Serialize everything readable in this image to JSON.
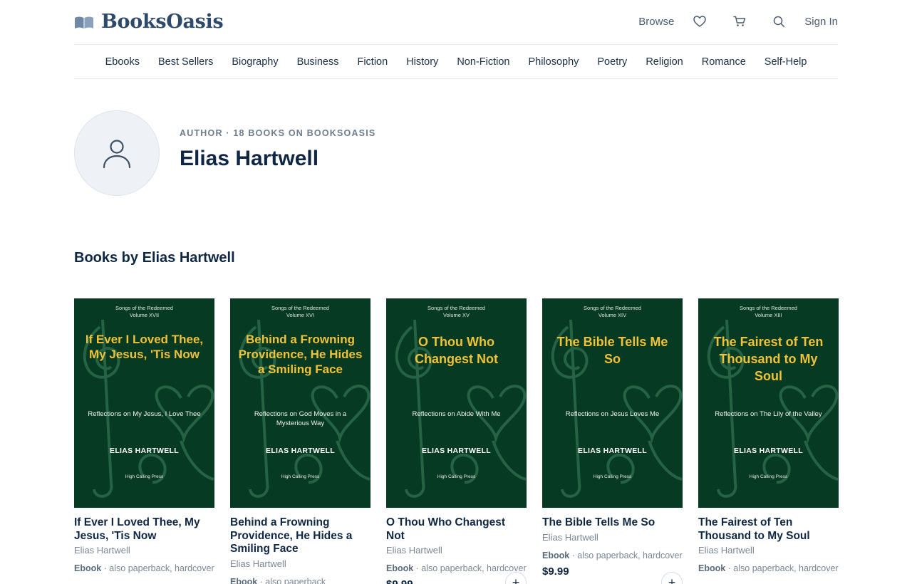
{
  "header": {
    "brand": "BooksOasis",
    "browse_label": "Browse",
    "signin_label": "Sign In",
    "icons": [
      "book-logo-icon",
      "heart-icon",
      "cart-icon",
      "search-icon"
    ]
  },
  "categories": [
    "Ebooks",
    "Best Sellers",
    "Biography",
    "Business",
    "Fiction",
    "History",
    "Non-Fiction",
    "Philosophy",
    "Poetry",
    "Religion",
    "Romance",
    "Self-Help"
  ],
  "author": {
    "meta": "AUTHOR · 18 BOOKS ON BOOKSOASIS",
    "name": "Elias Hartwell"
  },
  "section_title": "Books by Elias Hartwell",
  "colors": {
    "cover_bg": "#073a22",
    "cover_title": "#f0c23a",
    "text_primary": "#0f2744"
  },
  "books": [
    {
      "series": "Songs of the Redeemed",
      "volume": "Volume XVII",
      "cover_title": "If Ever I Loved Thee, My Jesus, 'Tis Now",
      "cover_subtitle": "Reflections on My Jesus, I Love Thee",
      "cover_author": "ELIAS HARTWELL",
      "publisher": "High Calling Press",
      "title": "If Ever I Loved Thee, My Jesus, 'Tis Now",
      "author": "Elias Hartwell",
      "format": "Ebook",
      "also": " · also paperback, hardcover"
    },
    {
      "series": "Songs of the Redeemed",
      "volume": "Volume XVI",
      "cover_title": "Behind a Frowning Providence, He Hides a Smiling Face",
      "cover_subtitle": "Reflections on God Moves in a Mysterious Way",
      "cover_author": "ELIAS HARTWELL",
      "publisher": "High Calling Press",
      "title": "Behind a Frowning Providence, He Hides a Smiling Face",
      "author": "Elias Hartwell",
      "format": "Ebook",
      "also": " · also paperback"
    },
    {
      "series": "Songs of the Redeemed",
      "volume": "Volume XV",
      "cover_title": "O Thou Who Changest Not",
      "cover_subtitle": "Reflections on Abide With Me",
      "cover_author": "ELIAS HARTWELL",
      "publisher": "High Calling Press",
      "title": "O Thou Who Changest Not",
      "author": "Elias Hartwell",
      "format": "Ebook",
      "also": " · also paperback, hardcover",
      "price": "$9.99"
    },
    {
      "series": "Songs of the Redeemed",
      "volume": "Volume XIV",
      "cover_title": "The Bible Tells Me So",
      "cover_subtitle": "Reflections on Jesus Loves Me",
      "cover_author": "ELIAS HARTWELL",
      "publisher": "High Calling Press",
      "title": "The Bible Tells Me So",
      "author": "Elias Hartwell",
      "format": "Ebook",
      "also": " · also paperback, hardcover",
      "price": "$9.99"
    },
    {
      "series": "Songs of the Redeemed",
      "volume": "Volume XIII",
      "cover_title": "The Fairest of Ten Thousand to My Soul",
      "cover_subtitle": "Reflections on The Lily of the Valley",
      "cover_author": "ELIAS HARTWELL",
      "publisher": "High Calling Press",
      "title": "The Fairest of Ten Thousand to My Soul",
      "author": "Elias Hartwell",
      "format": "Ebook",
      "also": " · also paperback, hardcover"
    }
  ]
}
